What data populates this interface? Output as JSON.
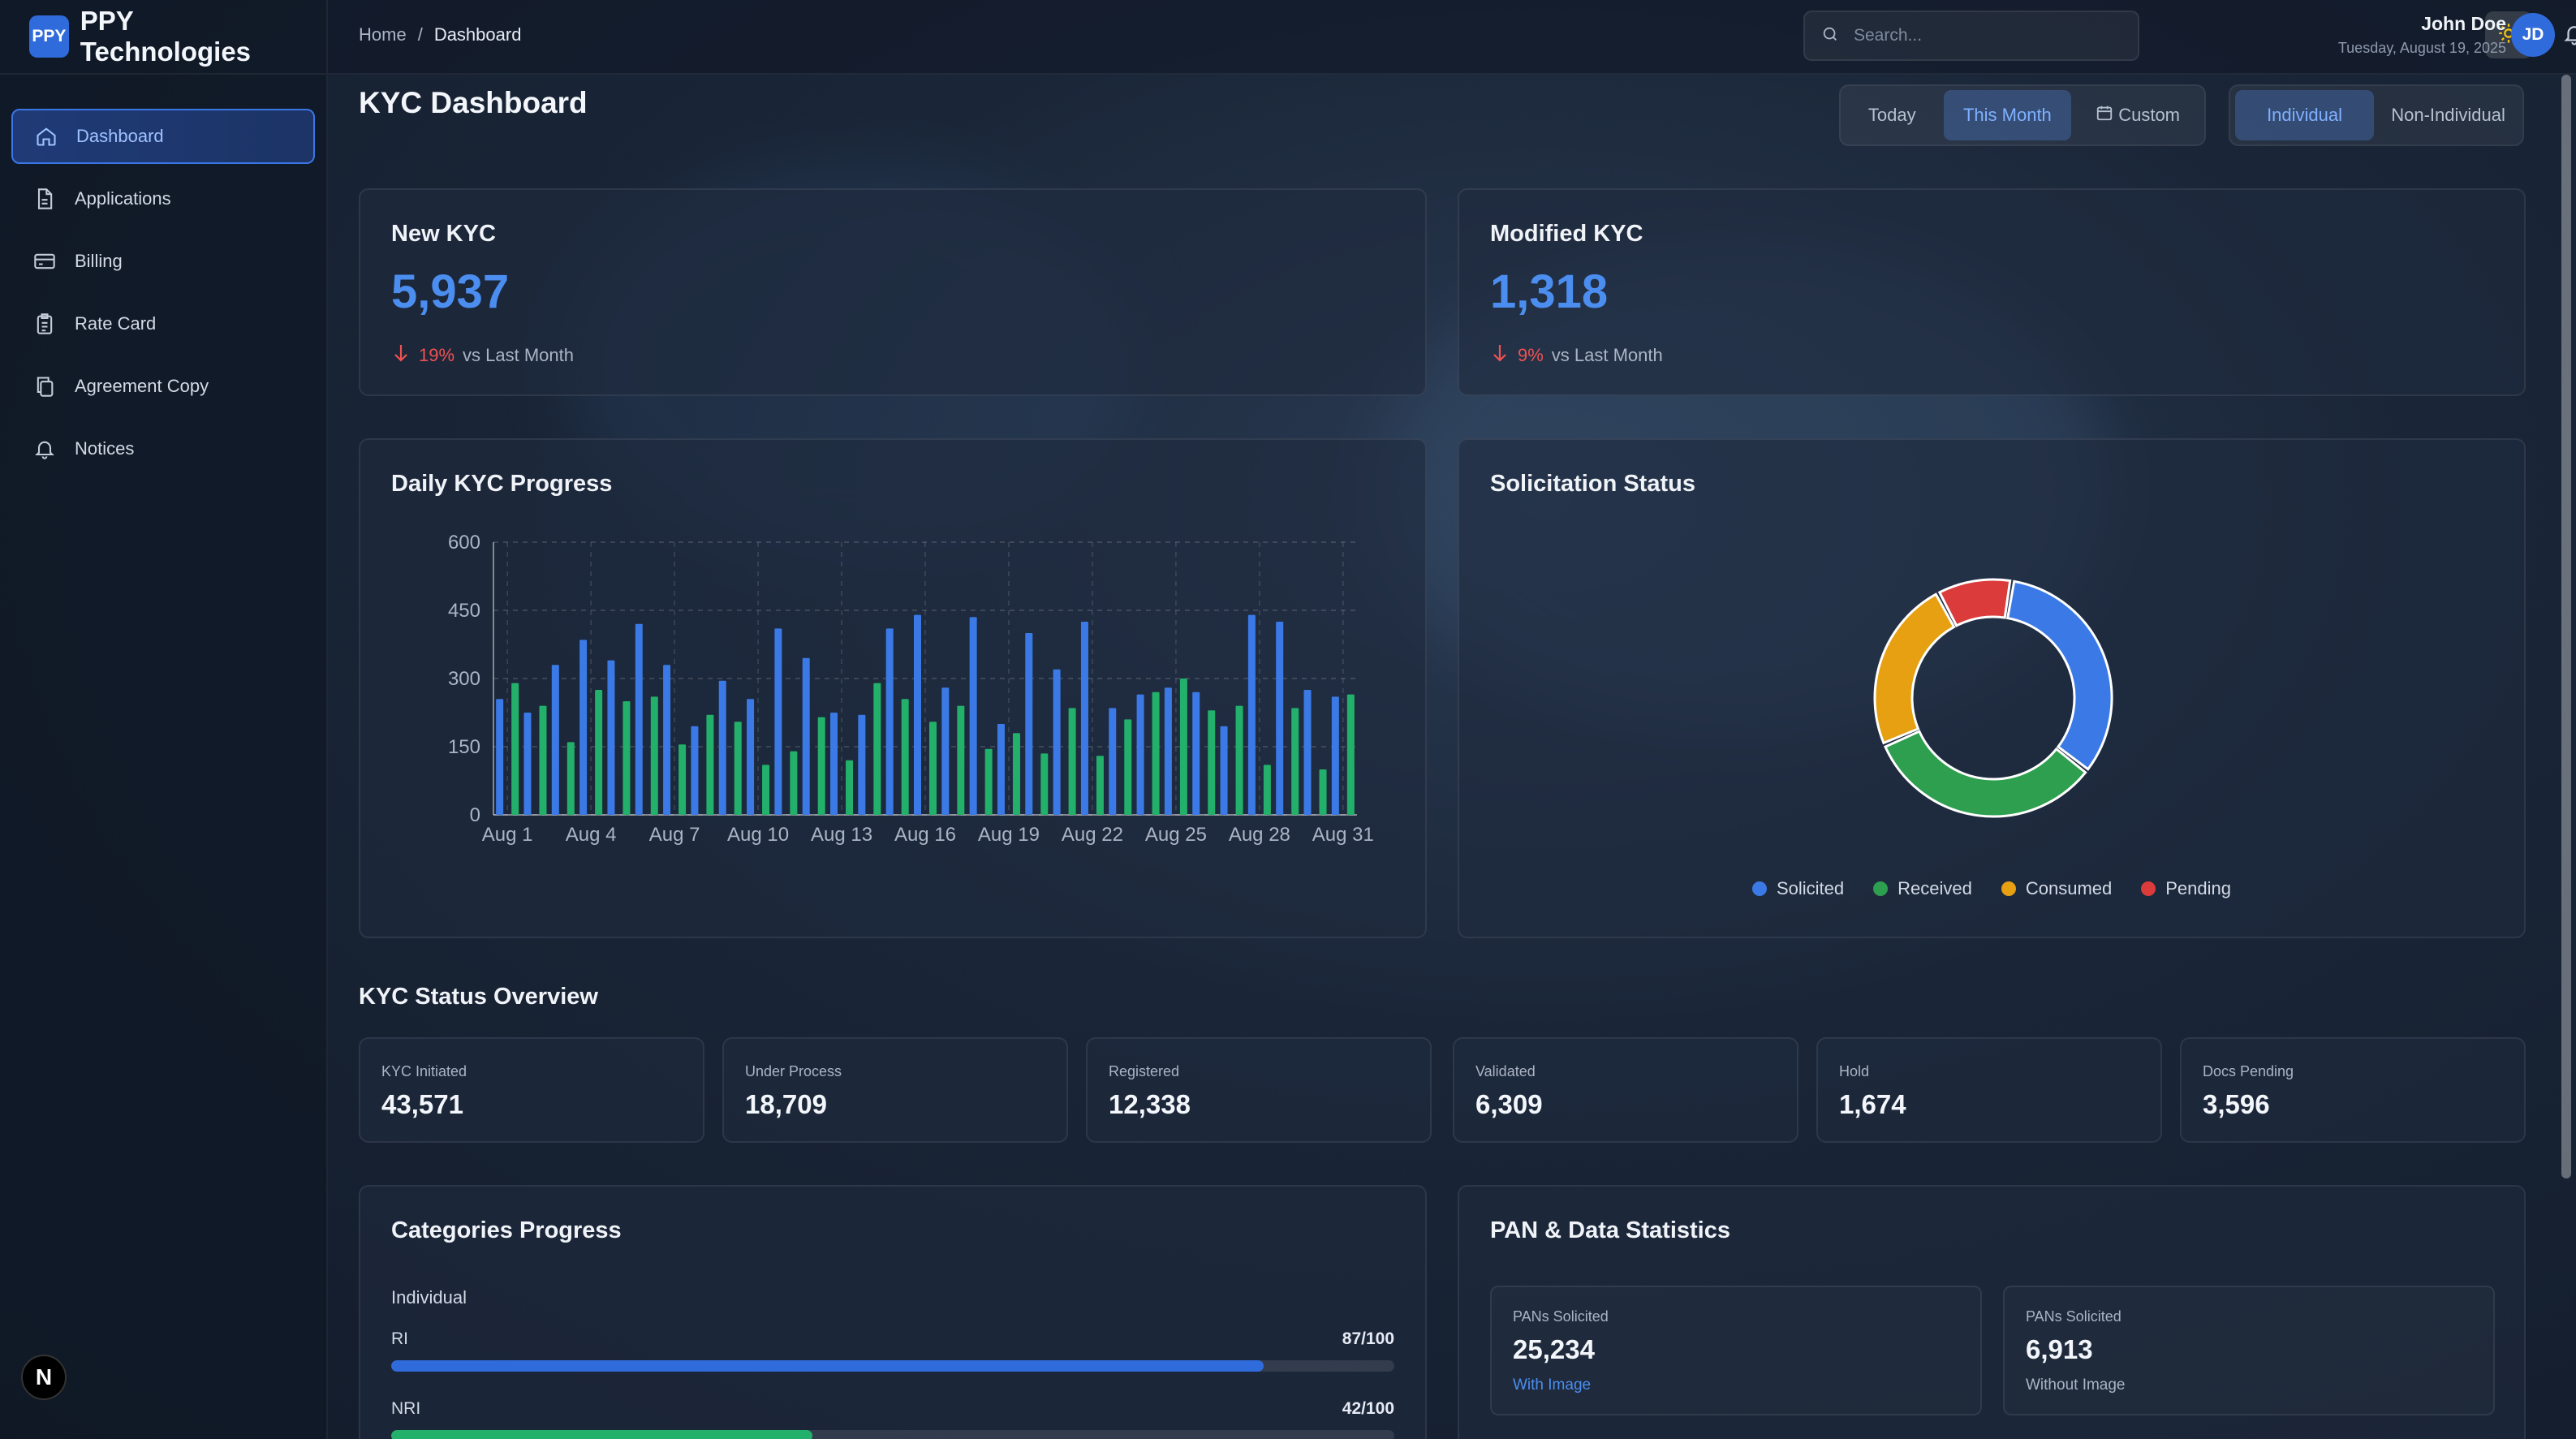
{
  "brand": {
    "logo_text": "PPY",
    "name": "PPY Technologies",
    "accent": "#2f6bdb"
  },
  "sidebar": {
    "items": [
      {
        "label": "Dashboard",
        "icon": "home-icon",
        "active": true
      },
      {
        "label": "Applications",
        "icon": "file-icon"
      },
      {
        "label": "Billing",
        "icon": "credit-card-icon"
      },
      {
        "label": "Rate Card",
        "icon": "clipboard-icon"
      },
      {
        "label": "Agreement Copy",
        "icon": "copy-icon"
      },
      {
        "label": "Notices",
        "icon": "bell-icon"
      }
    ],
    "footer_badge": "N"
  },
  "topbar": {
    "breadcrumb": {
      "home": "Home",
      "separator": "/",
      "current": "Dashboard"
    },
    "search_placeholder": "Search...",
    "theme_icon": "sun-icon",
    "notification_icon": "bell-icon",
    "user": {
      "name": "John Doe",
      "date": "Tuesday, August 19, 2025",
      "initials": "JD"
    }
  },
  "page": {
    "title": "KYC Dashboard",
    "period_filters": {
      "today": "Today",
      "this_month": "This Month",
      "custom": "Custom",
      "active": "This Month"
    },
    "type_filters": {
      "individual": "Individual",
      "non_individual": "Non-Individual",
      "active": "Individual"
    }
  },
  "kpis": {
    "new_kyc": {
      "title": "New KYC",
      "value": "5,937",
      "delta": "19%",
      "delta_text": "vs Last Month",
      "direction": "down"
    },
    "modified_kyc": {
      "title": "Modified KYC",
      "value": "1,318",
      "delta": "9%",
      "delta_text": "vs Last Month",
      "direction": "down"
    }
  },
  "daily_chart": {
    "title": "Daily KYC Progress",
    "colors": {
      "blue": "#3b7ae6",
      "green": "#22b06b"
    }
  },
  "chart_data": [
    {
      "type": "bar",
      "title": "Daily KYC Progress",
      "xlabel": "",
      "ylabel": "",
      "ylim": [
        0,
        600
      ],
      "yticks": [
        0,
        150,
        300,
        450,
        600
      ],
      "xticks": [
        "Aug 1",
        "Aug 4",
        "Aug 7",
        "Aug 10",
        "Aug 13",
        "Aug 16",
        "Aug 19",
        "Aug 22",
        "Aug 25",
        "Aug 28",
        "Aug 31"
      ],
      "grid": true,
      "categories": [
        "Aug 1",
        "Aug 2",
        "Aug 3",
        "Aug 4",
        "Aug 5",
        "Aug 6",
        "Aug 7",
        "Aug 8",
        "Aug 9",
        "Aug 10",
        "Aug 11",
        "Aug 12",
        "Aug 13",
        "Aug 14",
        "Aug 15",
        "Aug 16",
        "Aug 17",
        "Aug 18",
        "Aug 19",
        "Aug 20",
        "Aug 21",
        "Aug 22",
        "Aug 23",
        "Aug 24",
        "Aug 25",
        "Aug 26",
        "Aug 27",
        "Aug 28",
        "Aug 29",
        "Aug 30",
        "Aug 31"
      ],
      "series": [
        {
          "color": "#3b7ae6",
          "values": [
            255,
            225,
            330,
            385,
            340,
            420,
            330,
            195,
            295,
            255,
            410,
            345,
            225,
            220,
            410,
            440,
            280,
            435,
            200,
            400,
            320,
            425,
            235,
            265,
            280,
            270,
            195,
            440,
            425,
            275,
            260
          ]
        },
        {
          "color": "#22b06b",
          "values": [
            290,
            240,
            160,
            275,
            250,
            260,
            155,
            220,
            205,
            110,
            140,
            215,
            120,
            290,
            255,
            205,
            240,
            145,
            180,
            135,
            235,
            130,
            210,
            270,
            300,
            230,
            240,
            110,
            235,
            100,
            265
          ]
        }
      ]
    },
    {
      "type": "pie",
      "title": "Solicitation Status",
      "categories": [
        "Solicited",
        "Received",
        "Consumed",
        "Pending"
      ],
      "values": [
        32,
        32,
        23,
        10
      ],
      "colors": [
        "#3b7ae6",
        "#2e9e4f",
        "#e6a012",
        "#dc3b3b"
      ],
      "legend": "bottom"
    }
  ],
  "solicitation": {
    "title": "Solicitation Status",
    "legend": [
      "Solicited",
      "Received",
      "Consumed",
      "Pending"
    ]
  },
  "status_overview": {
    "title": "KYC Status Overview",
    "items": [
      {
        "label": "KYC Initiated",
        "value": "43,571"
      },
      {
        "label": "Under Process",
        "value": "18,709"
      },
      {
        "label": "Registered",
        "value": "12,338"
      },
      {
        "label": "Validated",
        "value": "6,309"
      },
      {
        "label": "Hold",
        "value": "1,674"
      },
      {
        "label": "Docs Pending",
        "value": "3,596"
      }
    ]
  },
  "categories": {
    "title": "Categories Progress",
    "group": "Individual",
    "rows": [
      {
        "label": "RI",
        "value": "87/100",
        "fraction": 0.87,
        "color": "#2f6bdb"
      },
      {
        "label": "NRI",
        "value": "42/100",
        "fraction": 0.42,
        "color": "#22b06b"
      }
    ]
  },
  "pan": {
    "title": "PAN & Data Statistics",
    "boxes": [
      {
        "label": "PANs Solicited",
        "value": "25,234",
        "sub": "With Image",
        "sub_color": "#4b8ef0"
      },
      {
        "label": "PANs Solicited",
        "value": "6,913",
        "sub": "Without Image",
        "sub_color": "#aab4c5"
      }
    ]
  }
}
